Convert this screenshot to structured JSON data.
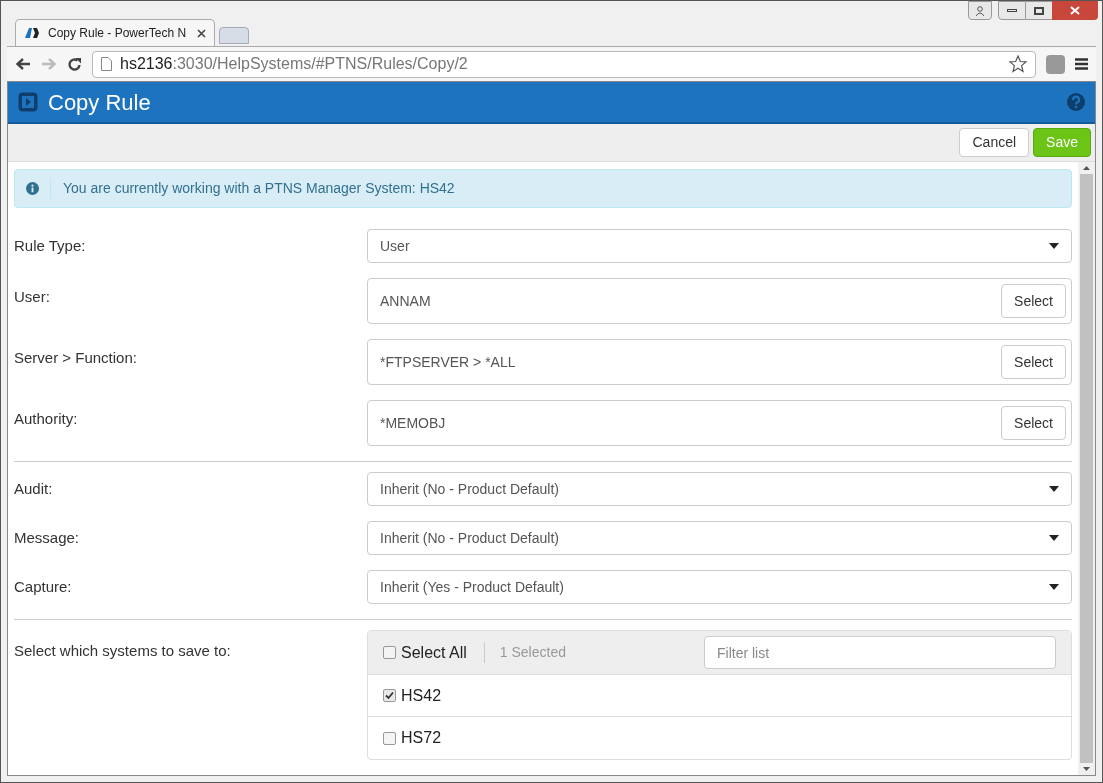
{
  "browser": {
    "tab_title": "Copy Rule - PowerTech N",
    "url_host": "hs2136",
    "url_path": ":3030/HelpSystems/#PTNS/Rules/Copy/2"
  },
  "header": {
    "title": "Copy Rule"
  },
  "toolbar": {
    "buttons": [
      {
        "label": "Cancel",
        "kind": "default"
      },
      {
        "label": "Save",
        "kind": "primary"
      }
    ]
  },
  "info": {
    "text": "You are currently working with a PTNS Manager System: HS42"
  },
  "sections": [
    [
      {
        "label": "Rule Type:",
        "kind": "select",
        "value": "User"
      },
      {
        "label": "User:",
        "kind": "picker",
        "value": "ANNAM",
        "button": "Select"
      },
      {
        "label": "Server > Function:",
        "kind": "picker",
        "value": "*FTPSERVER > *ALL",
        "button": "Select"
      },
      {
        "label": "Authority:",
        "kind": "picker",
        "value": "*MEMOBJ",
        "button": "Select"
      }
    ],
    [
      {
        "label": "Audit:",
        "kind": "select",
        "value": "Inherit (No - Product Default)"
      },
      {
        "label": "Message:",
        "kind": "select",
        "value": "Inherit (No - Product Default)"
      },
      {
        "label": "Capture:",
        "kind": "select",
        "value": "Inherit (Yes - Product Default)"
      }
    ]
  ],
  "systems": {
    "label": "Select which systems to save to:",
    "select_all": {
      "label": "Select All",
      "checked": false
    },
    "count": "1 Selected",
    "filter": {
      "placeholder": "Filter list"
    },
    "items": [
      {
        "label": "HS42",
        "checked": true
      },
      {
        "label": "HS72",
        "checked": false
      }
    ]
  }
}
